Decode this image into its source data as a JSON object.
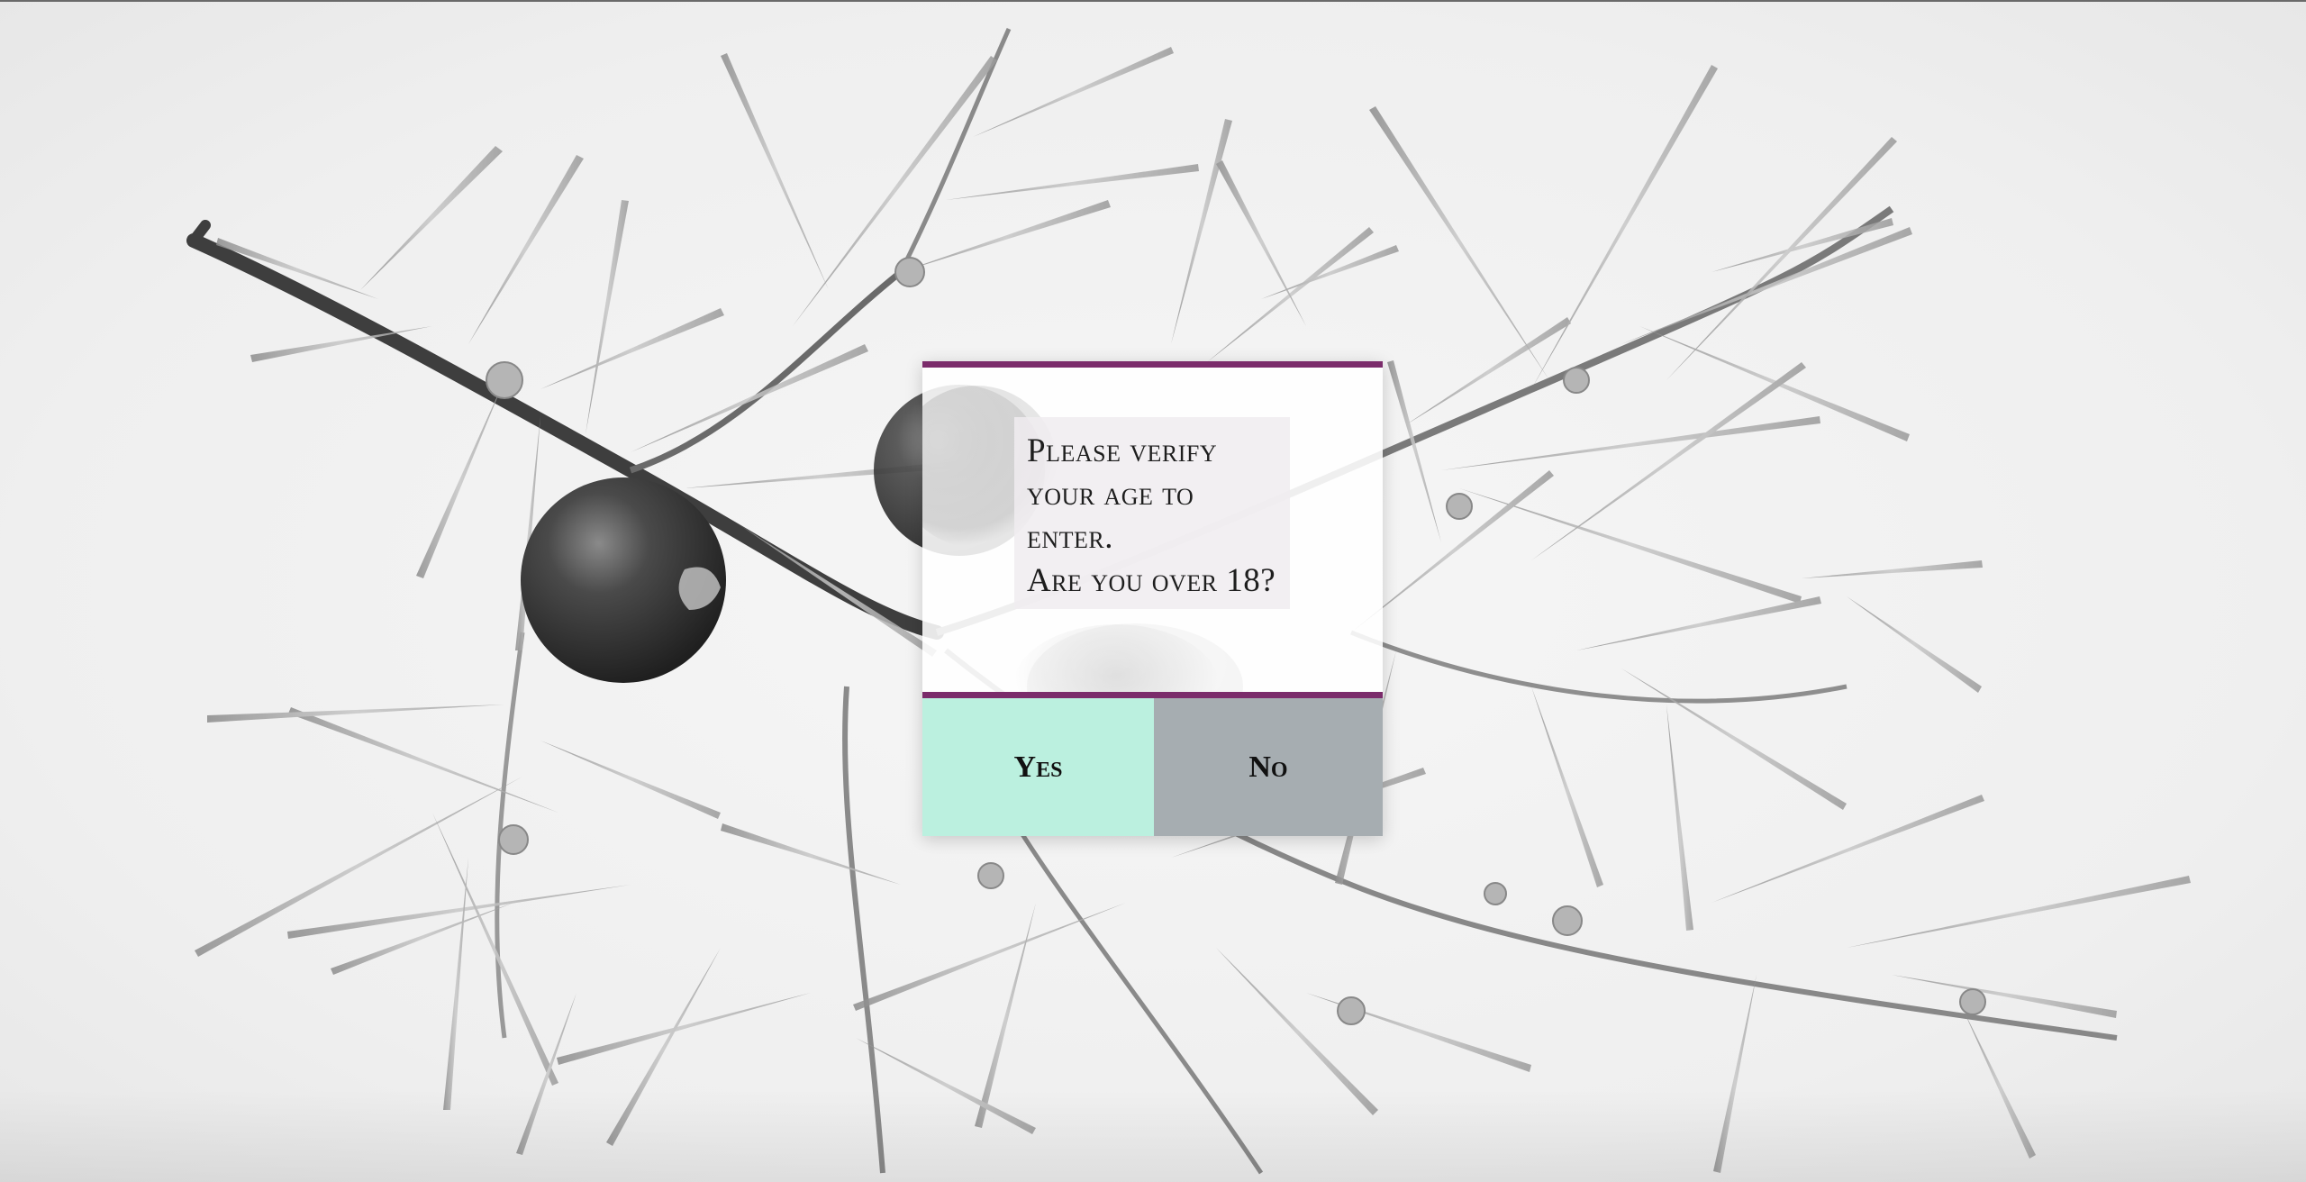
{
  "background": {
    "image": "juniper-branch-photo",
    "colors": {
      "page": "#f1f1f1",
      "branch": "#3a3a3a",
      "needles": "#9a9a9a",
      "berry": "#2b2b2b"
    }
  },
  "age_gate": {
    "message_lines": [
      "Please verify",
      "your age to",
      "enter.",
      "Are you over 18?"
    ],
    "yes_label": "Yes",
    "no_label": "No",
    "colors": {
      "accent_border": "#7b2c6b",
      "yes_bg": "#bbf0df",
      "no_bg": "#a6adb1"
    }
  }
}
